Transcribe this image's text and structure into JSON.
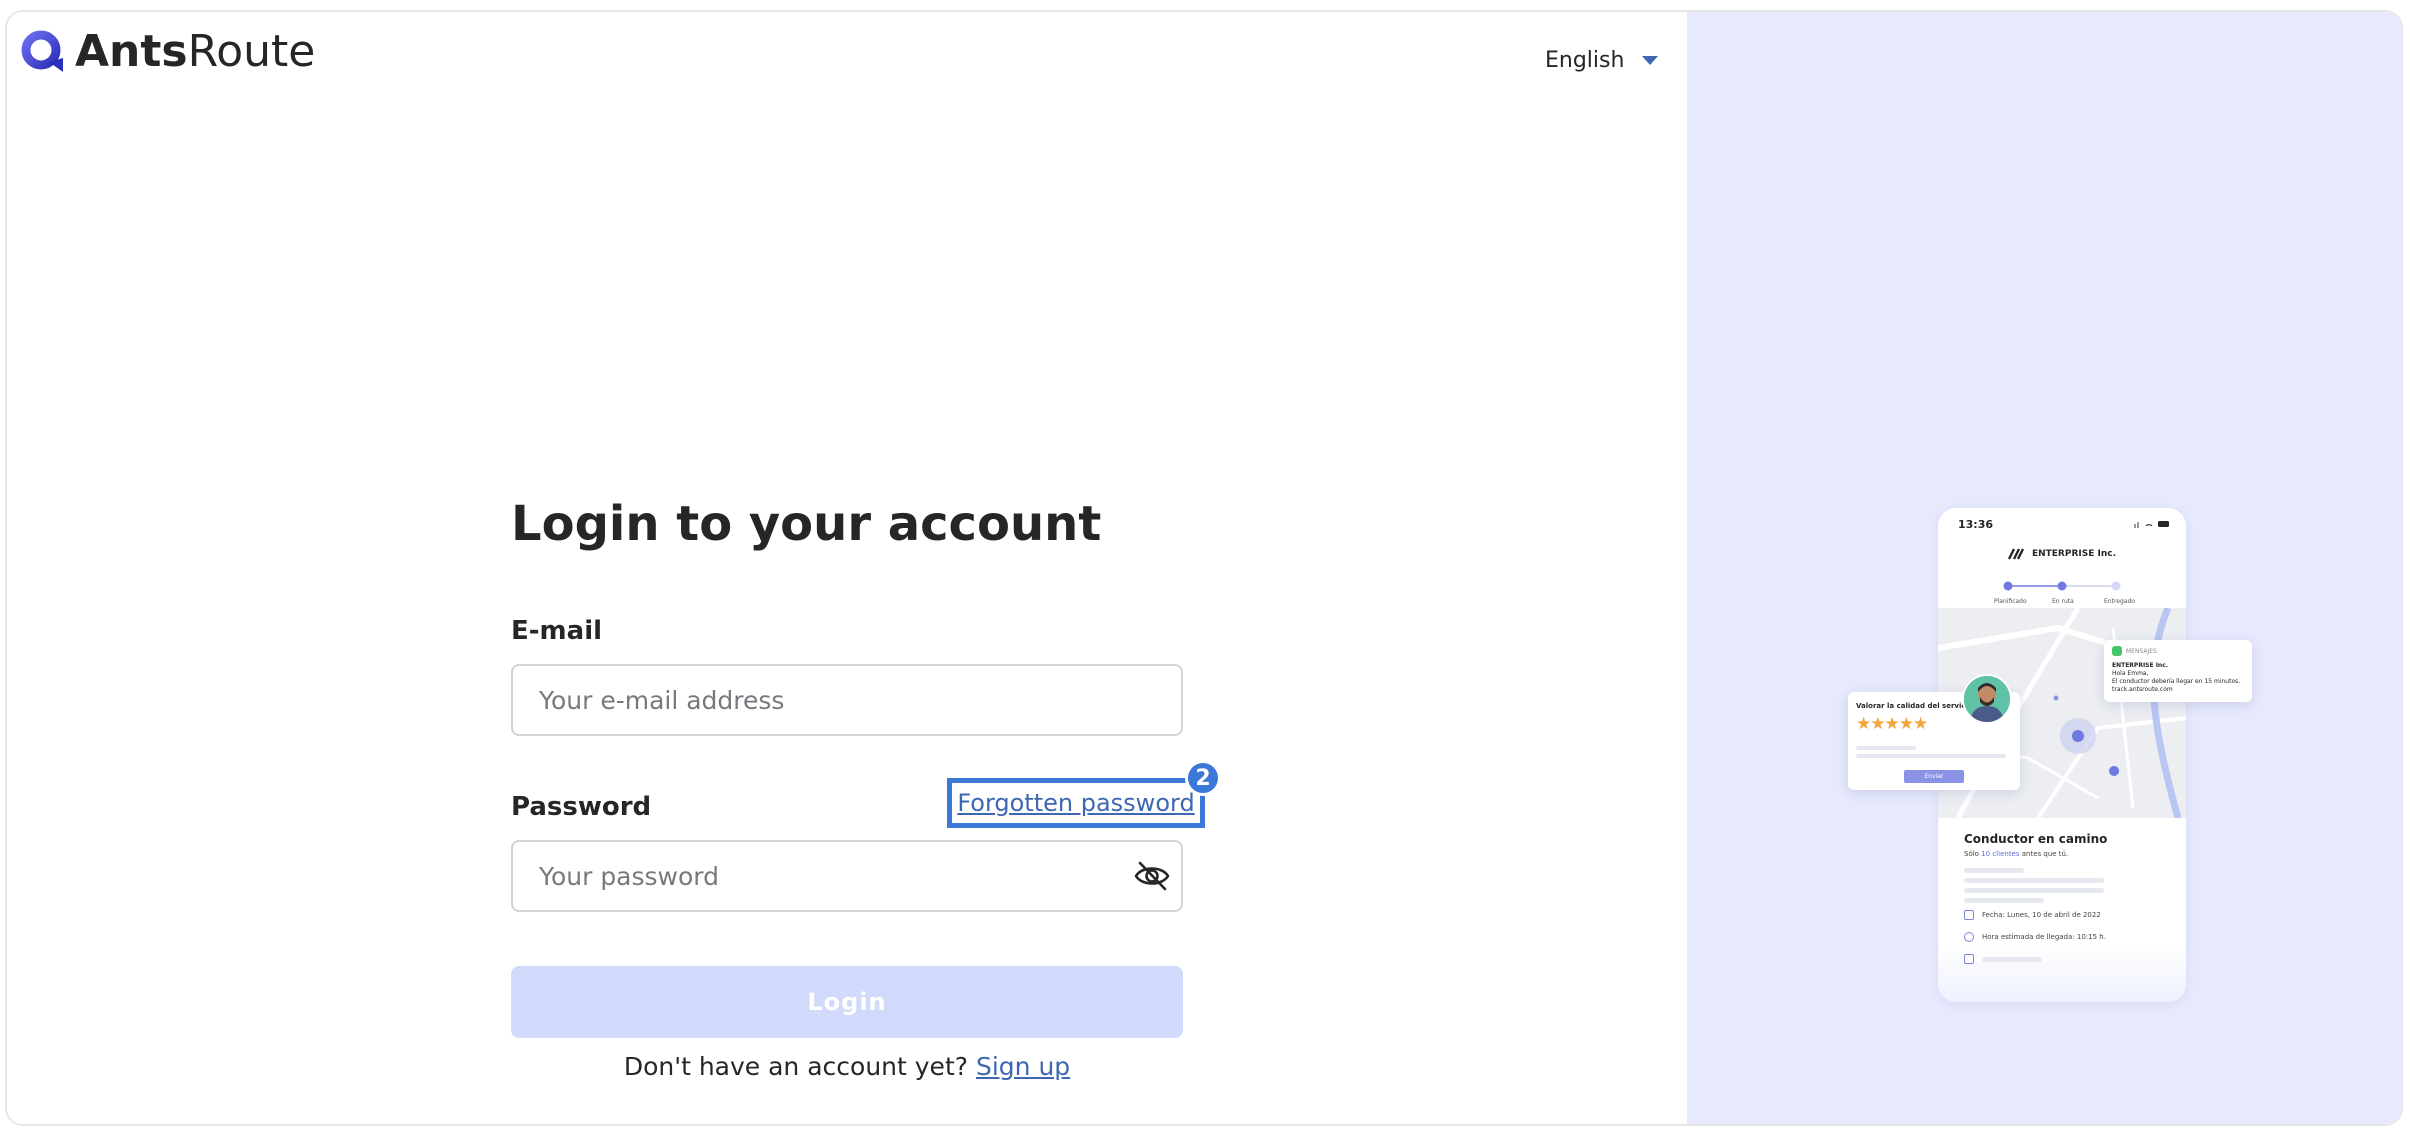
{
  "brand": {
    "name_bold": "Ants",
    "name_light": "Route"
  },
  "language": {
    "selected": "English"
  },
  "login": {
    "title": "Login to your account",
    "email_label": "E-mail",
    "email_placeholder": "Your e-mail address",
    "email_value": "",
    "password_label": "Password",
    "password_placeholder": "Your password",
    "password_value": "",
    "forgot_link": "Forgotten password",
    "forgot_badge": "2",
    "login_button": "Login",
    "signup_prompt": "Don't have an account yet?",
    "signup_link": "Sign up"
  },
  "illustration": {
    "time": "13:36",
    "company": "ENTERPRISE Inc.",
    "steps": [
      "Planificado",
      "En ruta",
      "Entregado"
    ],
    "driver_title": "Conductor en camino",
    "driver_sub_prefix": "Sólo",
    "driver_sub_highlight": "10 clientes",
    "driver_sub_suffix": "antes que tú.",
    "date_line": "Fecha: Lunes, 10 de abril de 2022",
    "eta_line": "Hora estimada de llegada: 10:15 h.",
    "rating_title": "Valorar la calidad del servicio",
    "rating_stars": "★★★★★",
    "rating_button": "Enviar",
    "sms_header": "MENSAJES",
    "sms_sender": "ENTERPRISE Inc.",
    "sms_greeting": "Hola Emma,",
    "sms_message": "El conductor debería llegar en 15 minutos.",
    "sms_link": "track.antsroute.com"
  },
  "colors": {
    "accent": "#3f67b1",
    "highlight": "#3b78d8",
    "login_button_disabled": "#d1dafb",
    "right_panel": "#e7eafd"
  }
}
